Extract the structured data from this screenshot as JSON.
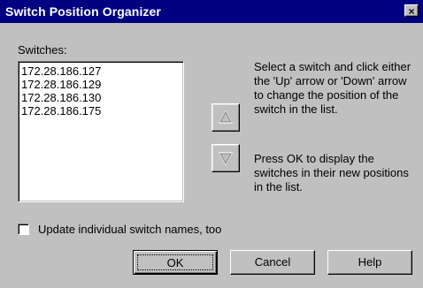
{
  "window": {
    "title": "Switch Position Organizer",
    "close_symbol": "×"
  },
  "switches_label": "Switches:",
  "switches": [
    "172.28.186.127",
    "172.28.186.129",
    "172.28.186.130",
    "172.28.186.175"
  ],
  "help": {
    "line1": "Select a switch and click either the 'Up' arrow or 'Down' arrow to change the position of the switch in the list.",
    "line2": "Press OK to display the switches in their new positions in the list."
  },
  "checkbox": {
    "label": "Update individual switch names, too",
    "checked": false
  },
  "buttons": {
    "ok": "OK",
    "cancel": "Cancel",
    "help": "Help"
  },
  "icons": {
    "up": "up-arrow-icon",
    "down": "down-arrow-icon"
  },
  "colors": {
    "titlebar": "#000080",
    "face": "#c0c0c0"
  }
}
